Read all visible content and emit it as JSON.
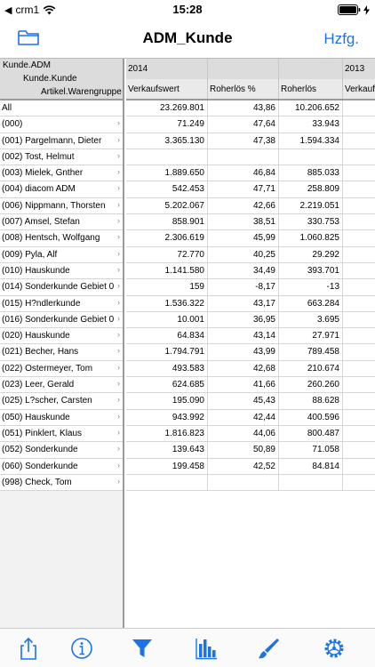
{
  "status": {
    "carrier": "crm1",
    "time": "15:28"
  },
  "nav": {
    "title": "ADM_Kunde",
    "right_button": "Hzfg."
  },
  "grid": {
    "row_header_levels": [
      "Kunde.ADM",
      "Kunde.Kunde",
      "Artikel.Warengruppe"
    ],
    "years": [
      "2014",
      "2013"
    ],
    "columns": [
      "Verkaufswert",
      "Roherlös %",
      "Roherlös",
      "Verkaufs"
    ],
    "rows": [
      {
        "label": "All",
        "chevron": "",
        "verkaufswert": "23.269.801",
        "roherloes_pct": "43,86",
        "roherloes": "10.206.652"
      },
      {
        "label": "(000)",
        "chevron": "›",
        "verkaufswert": "71.249",
        "roherloes_pct": "47,64",
        "roherloes": "33.943"
      },
      {
        "label": "(001) Pargelmann, Dieter",
        "chevron": "›",
        "verkaufswert": "3.365.130",
        "roherloes_pct": "47,38",
        "roherloes": "1.594.334"
      },
      {
        "label": "(002) Tost, Helmut",
        "chevron": "›",
        "verkaufswert": "",
        "roherloes_pct": "",
        "roherloes": ""
      },
      {
        "label": "(003) Mielek, Gnther",
        "chevron": "›",
        "verkaufswert": "1.889.650",
        "roherloes_pct": "46,84",
        "roherloes": "885.033"
      },
      {
        "label": "(004) diacom ADM",
        "chevron": "›",
        "verkaufswert": "542.453",
        "roherloes_pct": "47,71",
        "roherloes": "258.809"
      },
      {
        "label": "(006) Nippmann, Thorsten",
        "chevron": "›",
        "verkaufswert": "5.202.067",
        "roherloes_pct": "42,66",
        "roherloes": "2.219.051"
      },
      {
        "label": "(007) Amsel, Stefan",
        "chevron": "›",
        "verkaufswert": "858.901",
        "roherloes_pct": "38,51",
        "roherloes": "330.753"
      },
      {
        "label": "(008) Hentsch, Wolfgang",
        "chevron": "›",
        "verkaufswert": "2.306.619",
        "roherloes_pct": "45,99",
        "roherloes": "1.060.825"
      },
      {
        "label": "(009) Pyla, Alf",
        "chevron": "›",
        "verkaufswert": "72.770",
        "roherloes_pct": "40,25",
        "roherloes": "29.292"
      },
      {
        "label": "(010) Hauskunde",
        "chevron": "›",
        "verkaufswert": "1.141.580",
        "roherloes_pct": "34,49",
        "roherloes": "393.701"
      },
      {
        "label": "(014) Sonderkunde Gebiet 0",
        "chevron": "›",
        "verkaufswert": "159",
        "roherloes_pct": "-8,17",
        "roherloes": "-13"
      },
      {
        "label": "(015) H?ndlerkunde",
        "chevron": "›",
        "verkaufswert": "1.536.322",
        "roherloes_pct": "43,17",
        "roherloes": "663.284"
      },
      {
        "label": "(016) Sonderkunde Gebiet 0",
        "chevron": "›",
        "verkaufswert": "10.001",
        "roherloes_pct": "36,95",
        "roherloes": "3.695"
      },
      {
        "label": "(020) Hauskunde",
        "chevron": "›",
        "verkaufswert": "64.834",
        "roherloes_pct": "43,14",
        "roherloes": "27.971"
      },
      {
        "label": "(021) Becher, Hans",
        "chevron": "›",
        "verkaufswert": "1.794.791",
        "roherloes_pct": "43,99",
        "roherloes": "789.458"
      },
      {
        "label": "(022) Ostermeyer, Tom",
        "chevron": "›",
        "verkaufswert": "493.583",
        "roherloes_pct": "42,68",
        "roherloes": "210.674"
      },
      {
        "label": "(023) Leer, Gerald",
        "chevron": "›",
        "verkaufswert": "624.685",
        "roherloes_pct": "41,66",
        "roherloes": "260.260"
      },
      {
        "label": "(025) L?scher, Carsten",
        "chevron": "›",
        "verkaufswert": "195.090",
        "roherloes_pct": "45,43",
        "roherloes": "88.628"
      },
      {
        "label": "(050) Hauskunde",
        "chevron": "›",
        "verkaufswert": "943.992",
        "roherloes_pct": "42,44",
        "roherloes": "400.596"
      },
      {
        "label": "(051) Pinklert, Klaus",
        "chevron": "›",
        "verkaufswert": "1.816.823",
        "roherloes_pct": "44,06",
        "roherloes": "800.487"
      },
      {
        "label": "(052) Sonderkunde",
        "chevron": "›",
        "verkaufswert": "139.643",
        "roherloes_pct": "50,89",
        "roherloes": "71.058"
      },
      {
        "label": "(060) Sonderkunde",
        "chevron": "›",
        "verkaufswert": "199.458",
        "roherloes_pct": "42,52",
        "roherloes": "84.814"
      },
      {
        "label": "(998) Check, Tom",
        "chevron": "›",
        "verkaufswert": "",
        "roherloes_pct": "",
        "roherloes": ""
      }
    ]
  },
  "toolbar": {
    "icons": [
      "share-icon",
      "info-icon",
      "filter-icon",
      "chart-icon",
      "brush-icon",
      "settings-icon"
    ],
    "accent_color": "#1a73e8"
  }
}
